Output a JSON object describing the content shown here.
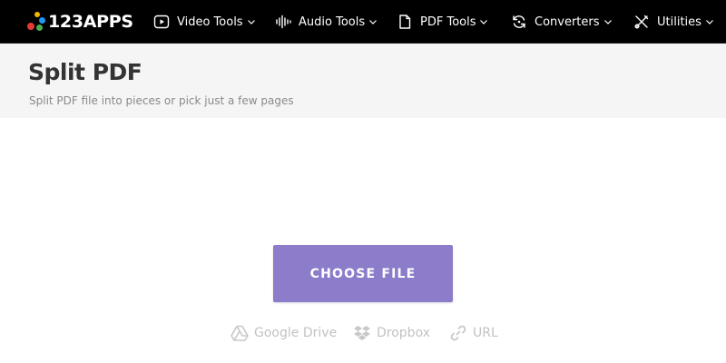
{
  "brand": {
    "name": "123APPS",
    "dot_colors": [
      "#f6b600",
      "#2196f3",
      "#e53935",
      "#4caf50"
    ]
  },
  "nav": {
    "items": [
      {
        "label": "Video Tools",
        "icon": "play-circle-icon"
      },
      {
        "label": "Audio Tools",
        "icon": "waveform-icon"
      },
      {
        "label": "PDF Tools",
        "icon": "document-icon"
      },
      {
        "label": "Converters",
        "icon": "refresh-icon"
      },
      {
        "label": "Utilities",
        "icon": "tools-icon"
      }
    ]
  },
  "page": {
    "title": "Split PDF",
    "subtitle": "Split PDF file into pieces or pick just a few pages"
  },
  "upload": {
    "button_label": "CHOOSE FILE",
    "button_color": "#8c7cc9",
    "sources": [
      {
        "label": "Google Drive",
        "icon": "google-drive-icon"
      },
      {
        "label": "Dropbox",
        "icon": "dropbox-icon"
      },
      {
        "label": "URL",
        "icon": "link-icon"
      }
    ]
  }
}
